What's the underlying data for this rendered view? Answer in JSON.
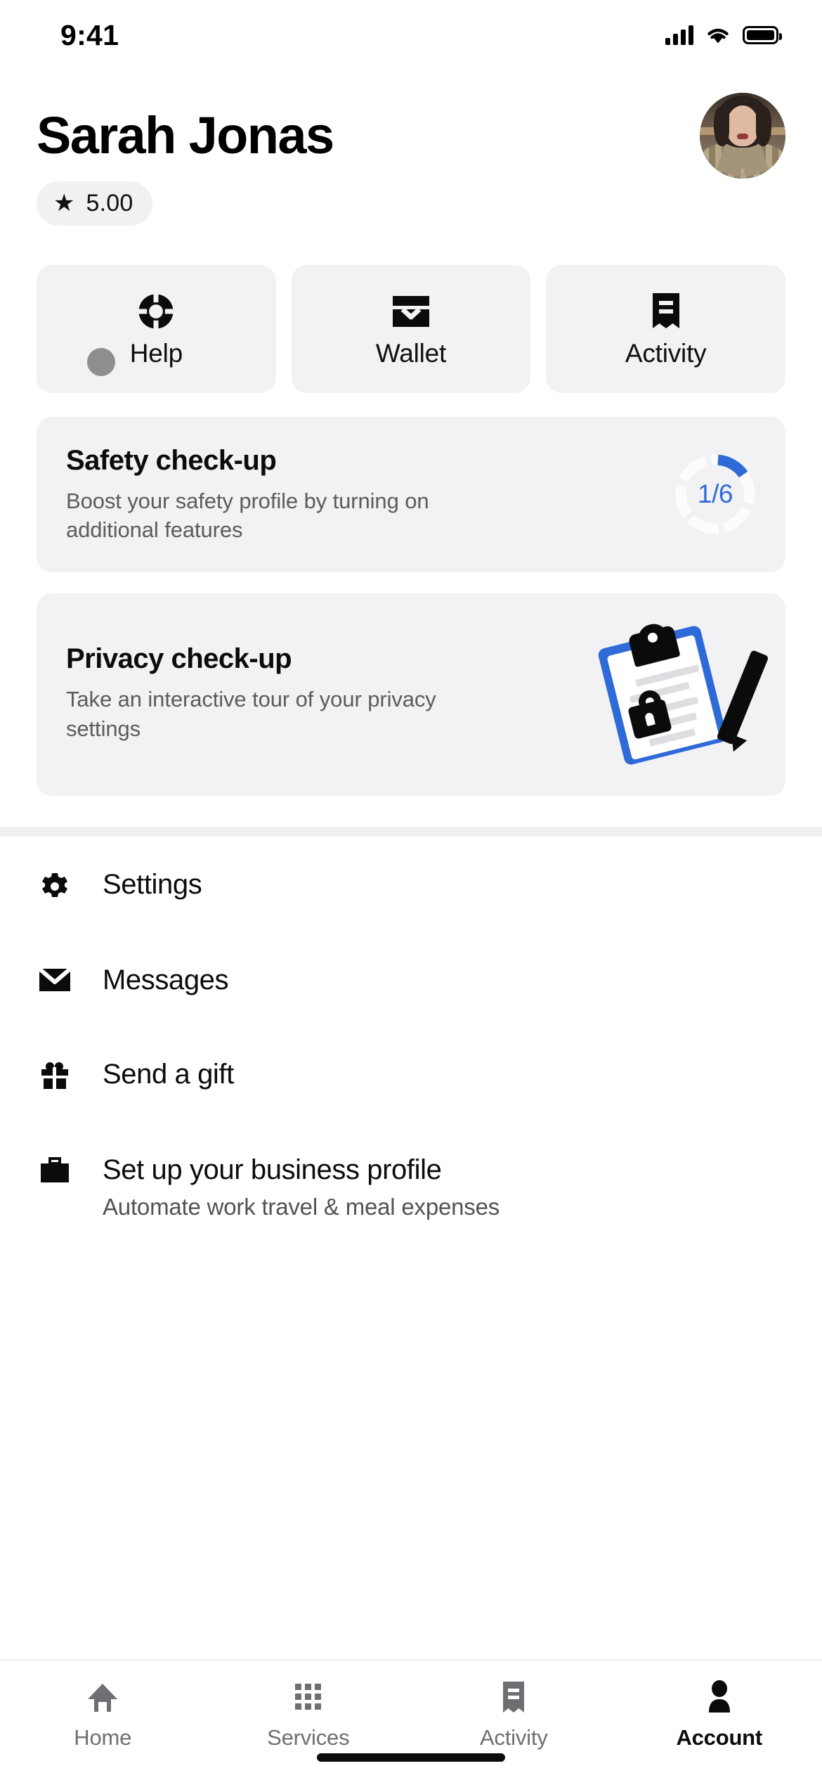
{
  "status_bar": {
    "time": "9:41",
    "icons": [
      "cellular-signal-icon",
      "wifi-icon",
      "battery-icon"
    ]
  },
  "profile": {
    "name": "Sarah Jonas",
    "rating": "5.00",
    "rating_icon": "star-icon",
    "avatar_alt": "avatar"
  },
  "quick_tiles": [
    {
      "label": "Help",
      "icon": "lifebuoy-icon"
    },
    {
      "label": "Wallet",
      "icon": "wallet-icon"
    },
    {
      "label": "Activity",
      "icon": "receipt-icon"
    }
  ],
  "cards": [
    {
      "title": "Safety check-up",
      "desc": "Boost your safety profile by turning on additional features",
      "progress_text": "1/6",
      "progress_done": 1,
      "progress_total": 6,
      "accent": "#2f6ad9"
    },
    {
      "title": "Privacy check-up",
      "desc": "Take an interactive tour of your privacy settings",
      "illustration": "clipboard-lock-icon",
      "accent": "#2f6ad9"
    }
  ],
  "menu": [
    {
      "label": "Settings",
      "icon": "gear-icon",
      "sub": ""
    },
    {
      "label": "Messages",
      "icon": "envelope-icon",
      "sub": ""
    },
    {
      "label": "Send a gift",
      "icon": "gift-icon",
      "sub": ""
    },
    {
      "label": "Set up your business profile",
      "icon": "briefcase-icon",
      "sub": "Automate work travel & meal expenses"
    }
  ],
  "tabs": [
    {
      "label": "Home",
      "icon": "home-icon",
      "active": false
    },
    {
      "label": "Services",
      "icon": "grid-icon",
      "active": false
    },
    {
      "label": "Activity",
      "icon": "receipt-icon",
      "active": false
    },
    {
      "label": "Account",
      "icon": "person-icon",
      "active": true
    }
  ],
  "colors": {
    "accent": "#2f6ad9",
    "surface": "#f2f2f4",
    "text": "#0c0c0c",
    "muted": "#5b5b60"
  }
}
